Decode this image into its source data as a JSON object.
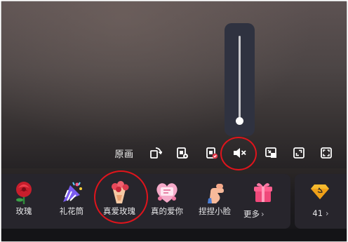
{
  "controls": {
    "resolution_label": "原画"
  },
  "gifts": [
    {
      "label": "玫瑰",
      "icon": "rose-icon"
    },
    {
      "label": "礼花筒",
      "icon": "party-popper-icon"
    },
    {
      "label": "真爱玫瑰",
      "icon": "true-love-rose-icon"
    },
    {
      "label": "真的爱你",
      "icon": "heart-card-icon"
    },
    {
      "label": "捏捏小脸",
      "icon": "pinch-face-icon"
    }
  ],
  "more": {
    "label": "更多",
    "chevron": "›",
    "icon": "gift-box-icon"
  },
  "diamonds": {
    "count": "41",
    "chevron": "›",
    "icon": "diamond-icon"
  },
  "colors": {
    "highlight": "#e0141c",
    "panel": "#27252c",
    "volume_panel": "#2f3240"
  },
  "volume": {
    "state": "muted",
    "level": 0.0
  }
}
